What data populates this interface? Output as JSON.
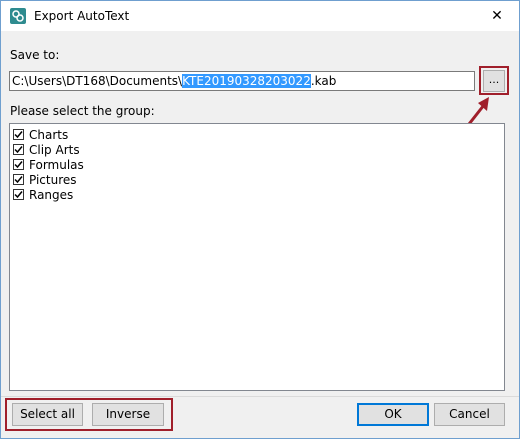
{
  "window": {
    "title": "Export AutoText",
    "close_label": "✕"
  },
  "save_to": {
    "label": "Save to:",
    "path_prefix": "C:\\Users\\DT168\\Documents\\",
    "path_selected": "KTE20190328203022",
    "path_suffix": ".kab",
    "browse_label": "..."
  },
  "groups": {
    "label": "Please select the group:",
    "items": [
      {
        "label": "Charts",
        "checked": true
      },
      {
        "label": "Clip Arts",
        "checked": true
      },
      {
        "label": "Formulas",
        "checked": true
      },
      {
        "label": "Pictures",
        "checked": true
      },
      {
        "label": "Ranges",
        "checked": true
      }
    ]
  },
  "buttons": {
    "select_all": "Select all",
    "inverse": "Inverse",
    "ok": "OK",
    "cancel": "Cancel"
  },
  "colors": {
    "annotation_red": "#a01f2b",
    "selection_blue": "#3399ff",
    "icon_teal": "#2e8b8f"
  }
}
